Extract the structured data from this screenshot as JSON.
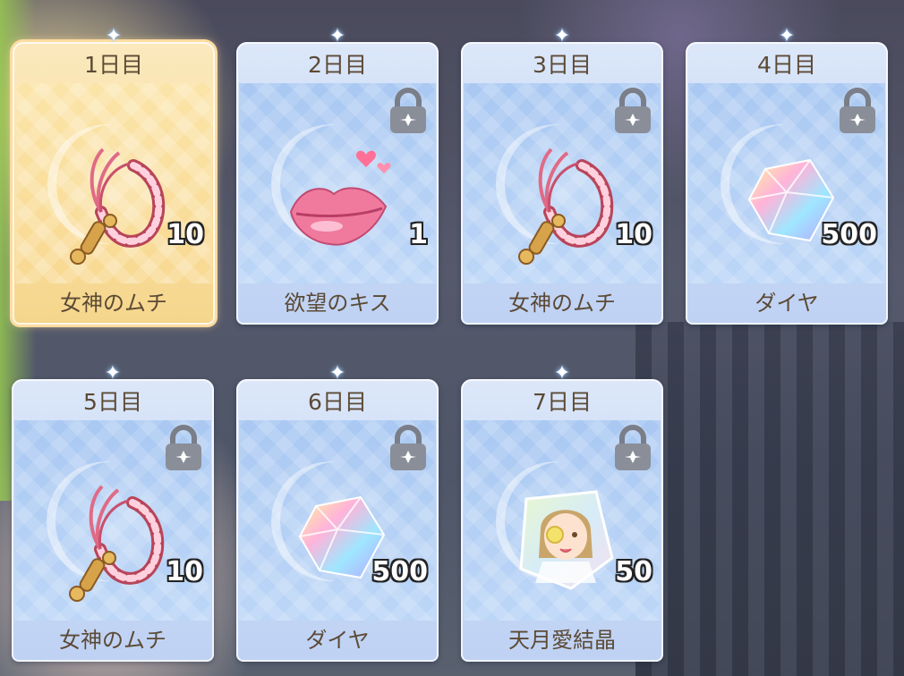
{
  "rewards": [
    {
      "day": "1日目",
      "item": "女神のムチ",
      "qty": "10",
      "icon": "whip-icon",
      "locked": false,
      "active": true
    },
    {
      "day": "2日目",
      "item": "欲望のキス",
      "qty": "1",
      "icon": "kiss-lips-icon",
      "locked": true,
      "active": false
    },
    {
      "day": "3日目",
      "item": "女神のムチ",
      "qty": "10",
      "icon": "whip-icon",
      "locked": true,
      "active": false
    },
    {
      "day": "4日目",
      "item": "ダイヤ",
      "qty": "500",
      "icon": "diamond-icon",
      "locked": true,
      "active": false
    },
    {
      "day": "5日目",
      "item": "女神のムチ",
      "qty": "10",
      "icon": "whip-icon",
      "locked": true,
      "active": false
    },
    {
      "day": "6日目",
      "item": "ダイヤ",
      "qty": "500",
      "icon": "diamond-icon",
      "locked": true,
      "active": false
    },
    {
      "day": "7日目",
      "item": "天月愛結晶",
      "qty": "50",
      "icon": "character-crystal-icon",
      "locked": true,
      "active": false
    }
  ],
  "colors": {
    "active_card": "#f8dea0",
    "card": "#c7d8f6",
    "text": "#5c4a36"
  }
}
